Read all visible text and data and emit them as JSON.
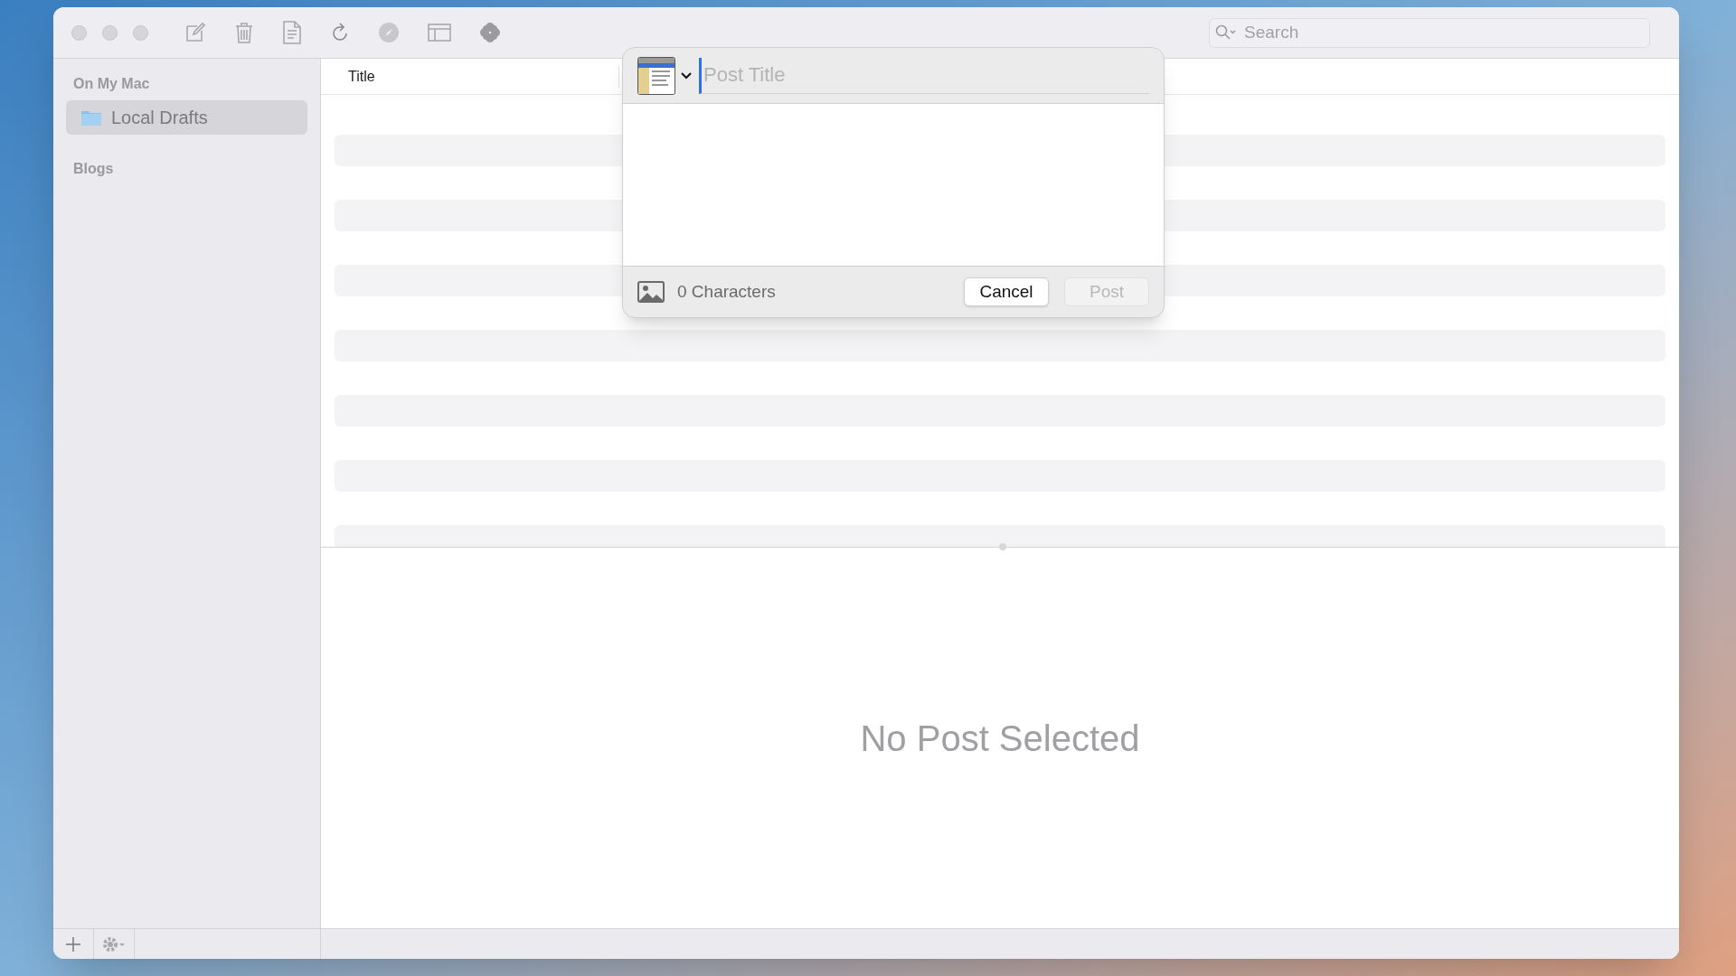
{
  "toolbar": {
    "search": {
      "placeholder": "Search"
    }
  },
  "sidebar": {
    "sections": [
      {
        "heading": "On My Mac",
        "items": [
          {
            "label": "Local Drafts",
            "selected": true
          }
        ]
      },
      {
        "heading": "Blogs"
      }
    ]
  },
  "post_list": {
    "columns": [
      "Title"
    ]
  },
  "new_post_popover": {
    "title_field": {
      "placeholder": "Post Title"
    },
    "character_count": "0 Characters",
    "buttons": [
      {
        "label": "Cancel",
        "disabled": false
      },
      {
        "label": "Post",
        "disabled": true
      }
    ]
  },
  "detail": {
    "empty_message": "No Post Selected"
  }
}
